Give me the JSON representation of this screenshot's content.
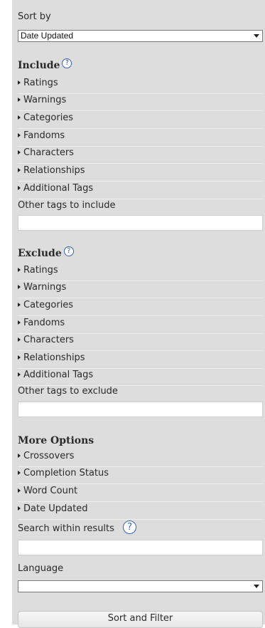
{
  "sort": {
    "label": "Sort by",
    "selected": "Date Updated"
  },
  "include": {
    "heading": "Include",
    "help_glyph": "?",
    "items": [
      "Ratings",
      "Warnings",
      "Categories",
      "Fandoms",
      "Characters",
      "Relationships",
      "Additional Tags"
    ],
    "other_label": "Other tags to include",
    "other_value": ""
  },
  "exclude": {
    "heading": "Exclude",
    "help_glyph": "?",
    "items": [
      "Ratings",
      "Warnings",
      "Categories",
      "Fandoms",
      "Characters",
      "Relationships",
      "Additional Tags"
    ],
    "other_label": "Other tags to exclude",
    "other_value": ""
  },
  "more": {
    "heading": "More Options",
    "items": [
      "Crossovers",
      "Completion Status",
      "Word Count",
      "Date Updated"
    ],
    "search_label": "Search within results",
    "search_help_glyph": "?",
    "search_value": "",
    "language_label": "Language",
    "language_selected": ""
  },
  "submit_label": "Sort and Filter",
  "icons": {
    "help": "question-circle-icon",
    "expander": "triangle-right-icon",
    "dropdown": "chevron-down-icon"
  },
  "colors": {
    "panel_bg": "#dddddd",
    "help_accent": "#3a63b5"
  }
}
